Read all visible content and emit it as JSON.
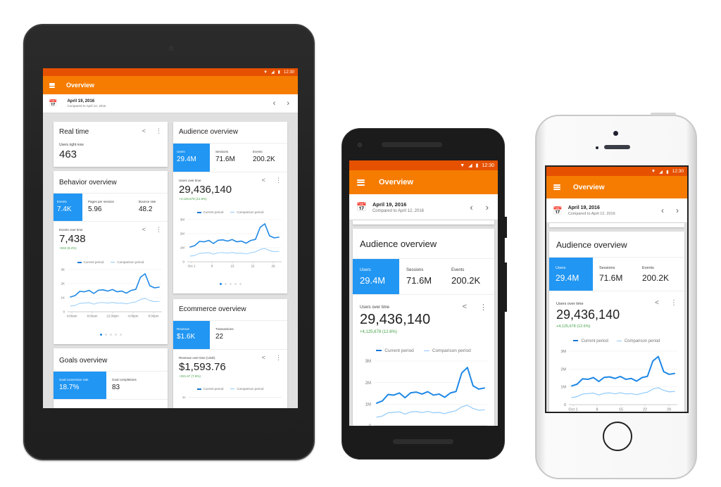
{
  "status_bar": {
    "time": "12:30",
    "wifi_icon": "wifi-icon",
    "signal_icon": "signal-icon",
    "battery_icon": "battery-icon"
  },
  "app_bar": {
    "menu_icon": "menu-icon",
    "title": "Overview"
  },
  "date_bar": {
    "calendar_icon": "calendar-icon",
    "date": "April 19, 2016",
    "comparison": "Compared to April 12, 2016",
    "prev_glyph": "‹",
    "next_glyph": "›"
  },
  "icons": {
    "share": "share-icon",
    "more": "more-vert-icon"
  },
  "legend": {
    "current": "Current period",
    "comparison": "Comparison period"
  },
  "colors": {
    "status_bar": "#e65100",
    "app_bar": "#f57c00",
    "accent": "#2196f3",
    "current_line": "#1e88e5",
    "comparison_line": "#90caf9",
    "delta_positive": "#43a047"
  },
  "cards": {
    "realtime": {
      "title": "Real time",
      "label": "Users right now",
      "value": "463"
    },
    "behavior": {
      "title": "Behavior overview",
      "metrics": [
        {
          "label": "Events",
          "value": "7.4K",
          "active": true
        },
        {
          "label": "Pages per session",
          "value": "5.96",
          "active": false
        },
        {
          "label": "Bounce rate",
          "value": "48.2",
          "active": false
        }
      ],
      "chart_label": "Events over time",
      "total": "7,438",
      "delta": "+932 (8.2%)",
      "pager": {
        "count": 5,
        "active": 0
      }
    },
    "goals": {
      "title": "Goals overview",
      "metrics": [
        {
          "label": "Goal conversion rate",
          "value": "18.7%",
          "active": true
        },
        {
          "label": "Goal completions",
          "value": "83",
          "active": false
        }
      ]
    },
    "audience": {
      "title": "Audience overview",
      "metrics": [
        {
          "label": "Users",
          "value": "29.4M",
          "active": true
        },
        {
          "label": "Sessions",
          "value": "71.6M",
          "active": false
        },
        {
          "label": "Events",
          "value": "200.2K",
          "active": false
        }
      ],
      "chart_label": "Users over time",
      "total": "29,436,140",
      "delta": "+4,125,678 (12.6%)",
      "pager": {
        "count": 5,
        "active": 0
      }
    },
    "ecommerce": {
      "title": "Ecommerce overview",
      "metrics": [
        {
          "label": "Revenue",
          "value": "$1.6K",
          "active": true
        },
        {
          "label": "Transactions",
          "value": "22",
          "active": false
        }
      ],
      "chart_label": "Revenue over time (USD)",
      "total": "$1,593.76",
      "delta": "+321.67 (7.6%)",
      "y_first_tick": "3K"
    }
  },
  "chart_data": [
    {
      "type": "line",
      "title": "Events over time",
      "x": [
        "4:00am",
        "",
        "",
        "",
        "8:00am",
        "",
        "",
        "",
        "12:00pm",
        "",
        "",
        "",
        "4:00pm",
        "",
        "",
        "",
        "8:00pm",
        ""
      ],
      "xtick_labels": [
        "4:00am",
        "8:00am",
        "12:00pm",
        "4:00pm",
        "8:00pm"
      ],
      "ytick_labels": [
        "0",
        "1K",
        "2K",
        "3K"
      ],
      "ylim": [
        0,
        3000
      ],
      "legend": "top-center",
      "series": [
        {
          "name": "Current period",
          "values": [
            1050,
            1150,
            1450,
            1420,
            1520,
            1300,
            1530,
            1560,
            1470,
            1580,
            1420,
            1470,
            1320,
            1520,
            1590,
            2450,
            2700,
            1850,
            1700,
            1750
          ]
        },
        {
          "name": "Comparison period",
          "values": [
            400,
            450,
            600,
            620,
            650,
            540,
            640,
            660,
            610,
            670,
            600,
            620,
            560,
            640,
            700,
            880,
            950,
            800,
            720,
            740
          ]
        }
      ]
    },
    {
      "type": "line",
      "title": "Users over time",
      "xtick_labels": [
        "Oct 1",
        "8",
        "15",
        "22",
        "29"
      ],
      "ytick_labels": [
        "0",
        "1M",
        "2M",
        "3M"
      ],
      "ylim": [
        0,
        3000000
      ],
      "legend": "top-center",
      "series": [
        {
          "name": "Current period",
          "values": [
            1050000,
            1150000,
            1450000,
            1420000,
            1520000,
            1300000,
            1530000,
            1560000,
            1470000,
            1580000,
            1420000,
            1470000,
            1320000,
            1520000,
            1590000,
            2450000,
            2700000,
            1850000,
            1700000,
            1750000
          ]
        },
        {
          "name": "Comparison period",
          "values": [
            400000,
            450000,
            600000,
            620000,
            650000,
            540000,
            640000,
            660000,
            610000,
            670000,
            600000,
            620000,
            560000,
            640000,
            700000,
            880000,
            950000,
            800000,
            720000,
            740000
          ]
        }
      ]
    }
  ]
}
